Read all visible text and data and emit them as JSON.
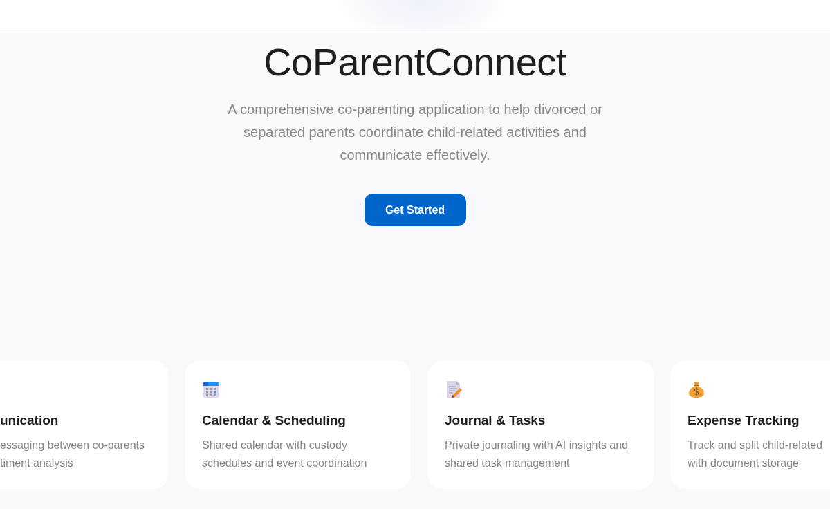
{
  "hero": {
    "title": "CoParentConnect",
    "description": "A comprehensive co-parenting application to help divorced or separated parents coordinate child-related activities and communicate effectively.",
    "button": "Get Started"
  },
  "features": [
    {
      "title": "unication",
      "description_lines": [
        "essaging between co-parents",
        "timent analysis"
      ]
    },
    {
      "title": "Calendar & Scheduling",
      "description_lines": [
        "Shared calendar with custody",
        "schedules and event coordination"
      ]
    },
    {
      "title": "Journal & Tasks",
      "description_lines": [
        "Private journaling with AI insights and",
        "shared task management"
      ]
    },
    {
      "title": "Expense Tracking",
      "description_lines": [
        "Track and split child-related",
        "with document storage"
      ]
    }
  ]
}
